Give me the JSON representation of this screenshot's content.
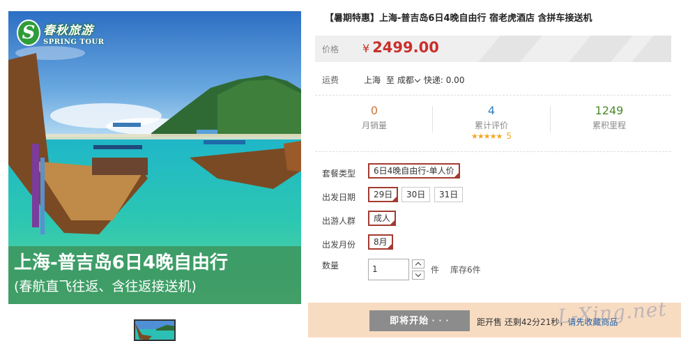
{
  "gallery": {
    "brand_cn": "春秋旅游",
    "brand_en": "SPRING TOUR",
    "brand_mark": "S",
    "caption_title": "上海-普吉岛6日4晚自由行",
    "caption_subtitle": "(春航直飞往返、含往返接送机)"
  },
  "product": {
    "title": "【暑期特惠】上海-普吉岛6日4晚自由行 宿老虎酒店 含拼车接送机",
    "price_label": "价格",
    "currency": "¥",
    "price": "2499.00",
    "price_color": "#c9302c"
  },
  "freight": {
    "label": "运费",
    "from": "上海",
    "to_word": "至",
    "dest": "成都",
    "express": "快递: 0.00"
  },
  "stats": [
    {
      "value": "0",
      "label": "月销量",
      "color": "#c9763a"
    },
    {
      "value": "4",
      "label": "累计评价",
      "color": "#2f7ec1",
      "stars": "★★★★★",
      "score": "5"
    },
    {
      "value": "1249",
      "label": "累积里程",
      "color": "#4a8c2a"
    }
  ],
  "options": {
    "package": {
      "label": "套餐类型",
      "values": [
        "6日4晚自由行-单人价"
      ],
      "selected": "6日4晚自由行-单人价"
    },
    "date": {
      "label": "出发日期",
      "values": [
        "29日",
        "30日",
        "31日"
      ],
      "selected": "29日"
    },
    "crowd": {
      "label": "出游人群",
      "values": [
        "成人"
      ],
      "selected": "成人"
    },
    "month": {
      "label": "出发月份",
      "values": [
        "8月"
      ],
      "selected": "8月"
    }
  },
  "quantity": {
    "label": "数量",
    "value": "1",
    "unit": "件",
    "stock": "库存6件"
  },
  "buy": {
    "button_label": "即将开始 · · ·",
    "countdown_prefix": "距开售 还剩42分21秒，",
    "countdown_link": "请先收藏商品",
    "bar_color": "#f7dcc2"
  },
  "watermark": "L-Xing.net"
}
